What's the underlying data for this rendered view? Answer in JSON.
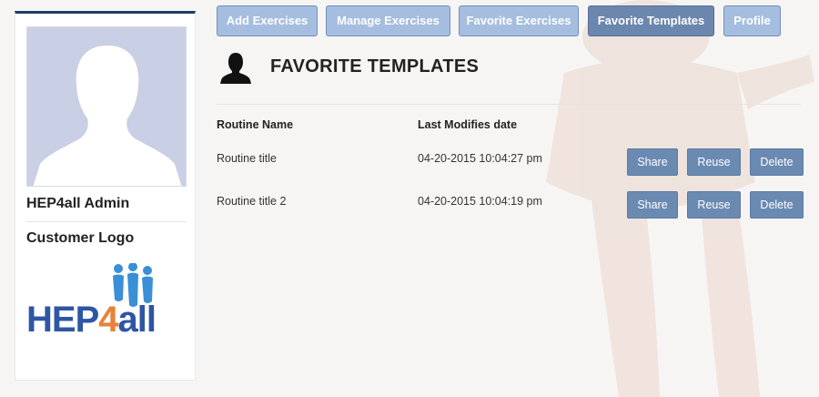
{
  "sidebar": {
    "admin_name": "HEP4all Admin",
    "logo_heading": "Customer Logo",
    "logo": {
      "text_part1": "HEP",
      "text_part2": "4",
      "text_part3": "all"
    }
  },
  "nav": {
    "tabs": [
      {
        "label": "Add Exercises",
        "active": false
      },
      {
        "label": "Manage Exercises",
        "active": false
      },
      {
        "label": "Favorite Exercises",
        "active": false
      },
      {
        "label": "Favorite Templates",
        "active": true
      },
      {
        "label": "Profile",
        "active": false
      }
    ]
  },
  "page": {
    "title": "FAVORITE TEMPLATES",
    "icon": "user-silhouette-icon"
  },
  "table": {
    "columns": [
      "Routine Name",
      "Last Modifies date"
    ],
    "rows": [
      {
        "name": "Routine title",
        "date": "04-20-2015 10:04:27 pm"
      },
      {
        "name": "Routine title 2",
        "date": "04-20-2015 10:04:19 pm"
      }
    ],
    "actions": [
      "Share",
      "Reuse",
      "Delete"
    ]
  },
  "colors": {
    "nav_button": "#a5bee0",
    "nav_button_active": "#6c87ae",
    "action_button": "#6b8ab2",
    "sidebar_top_border": "#1d3f66",
    "logo_blue": "#2d56a4",
    "logo_orange": "#e8823a"
  }
}
